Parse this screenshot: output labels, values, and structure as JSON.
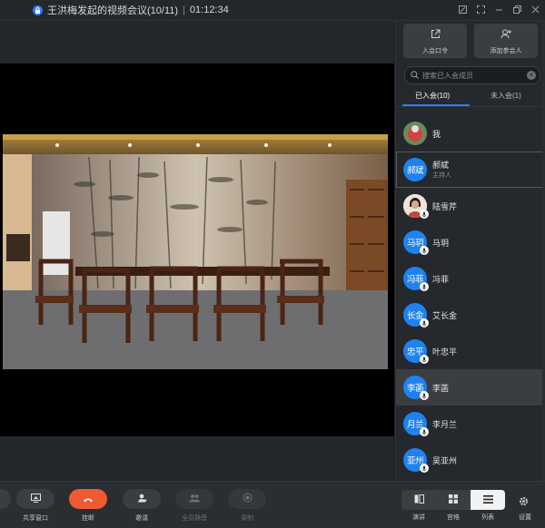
{
  "window": {
    "title": "王洪梅发起的视频会议(10/11)",
    "separator": "|",
    "elapsed": "01:12:34"
  },
  "toolbar": {
    "share_label": "共享窗口",
    "hangup_label": "挂断",
    "invite_label": "邀请",
    "mute_all_label": "全员静音",
    "record_label": "录制"
  },
  "layout_modes": {
    "present_label": "演讲",
    "grid_label": "宫格",
    "list_label": "列表",
    "settings_label": "设置"
  },
  "panel": {
    "entry_code_label": "入会口令",
    "add_participant_label": "添加参会人",
    "search_placeholder": "搜索已入会成员",
    "tab_joined": "已入会(10)",
    "tab_not_joined": "未入会(1)",
    "members": [
      {
        "name": "我",
        "avatar_text": "",
        "role": ""
      },
      {
        "name": "郝斌",
        "avatar_text": "郝斌",
        "role": "主持人"
      },
      {
        "name": "陆雪芹",
        "avatar_text": "",
        "role": ""
      },
      {
        "name": "马玥",
        "avatar_text": "马玥",
        "role": ""
      },
      {
        "name": "冯菲",
        "avatar_text": "冯菲",
        "role": ""
      },
      {
        "name": "艾长金",
        "avatar_text": "长金",
        "role": ""
      },
      {
        "name": "叶忠平",
        "avatar_text": "忠平",
        "role": ""
      },
      {
        "name": "李菡",
        "avatar_text": "李菡",
        "role": ""
      },
      {
        "name": "李月兰",
        "avatar_text": "月兰",
        "role": ""
      },
      {
        "name": "吴亚州",
        "avatar_text": "亚州",
        "role": ""
      }
    ]
  },
  "colors": {
    "accent": "#2f7cf6",
    "hangup": "#f05a32",
    "avatar": "#1f82f0"
  }
}
